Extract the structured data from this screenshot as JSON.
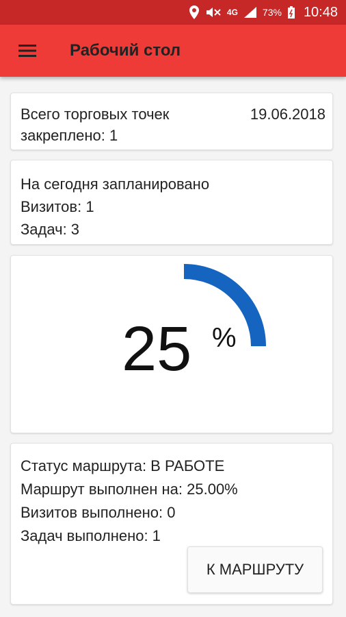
{
  "status_bar": {
    "battery": "73%",
    "network": "4G",
    "time": "10:48",
    "icons": [
      "location-icon",
      "mute-icon",
      "network-icon",
      "signal-icon",
      "battery-icon"
    ]
  },
  "app_bar": {
    "title": "Рабочий стол",
    "menu_icon": "menu-icon",
    "color": "#ef3b37"
  },
  "outlets": {
    "line1": "Всего торговых точек",
    "line2": "закреплено: 1",
    "date": "19.06.2018"
  },
  "plan": {
    "heading": "На сегодня запланировано",
    "visits": "Визитов: 1",
    "tasks": "Задач: 3"
  },
  "progress": {
    "value_text": "25",
    "unit": "%",
    "fraction": 0.25,
    "color": "#1565c0"
  },
  "route": {
    "status": "Статус маршрута: В РАБОТЕ",
    "completed": "Маршрут выполнен на: 25.00%",
    "visits_done": "Визитов выполнено: 0",
    "tasks_done": "Задач выполнено: 1",
    "button": "К МАРШРУТУ"
  }
}
